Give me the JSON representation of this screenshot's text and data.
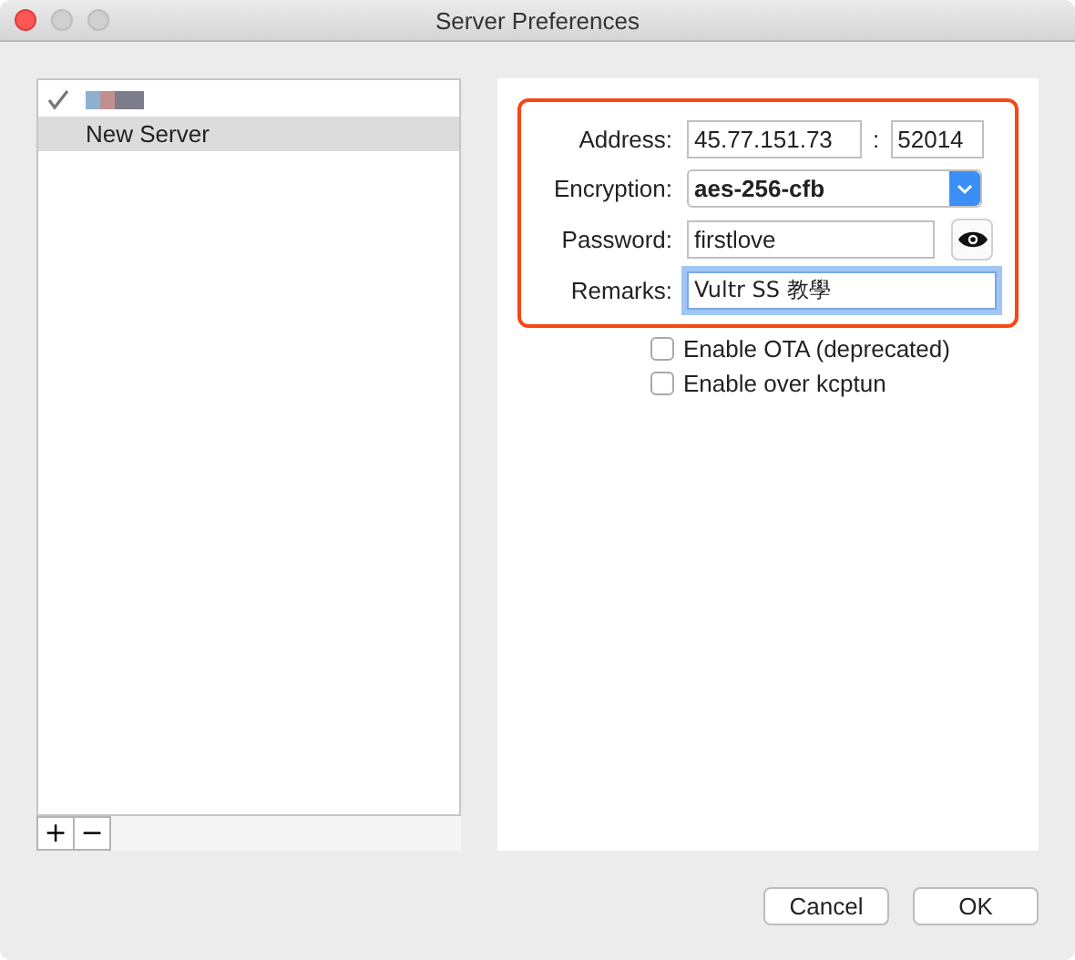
{
  "window": {
    "title": "Server Preferences"
  },
  "servers": [
    {
      "kind": "redacted",
      "checked": true,
      "selected": false
    },
    {
      "kind": "text",
      "name": "New Server",
      "checked": false,
      "selected": true
    }
  ],
  "list_buttons": [
    "+",
    "−"
  ],
  "form": {
    "address_label": "Address:",
    "address": "45.77.151.73",
    "port_separator": ":",
    "port": "52014",
    "encryption_label": "Encryption:",
    "encryption": "aes-256-cfb",
    "password_label": "Password:",
    "password": "firstlove",
    "remarks_label": "Remarks:",
    "remarks": "Vultr SS 教學",
    "highlighted": true
  },
  "options": [
    {
      "label": "Enable OTA (deprecated)",
      "checked": false
    },
    {
      "label": "Enable over kcptun",
      "checked": false
    }
  ],
  "buttons": [
    "Cancel",
    "OK"
  ]
}
